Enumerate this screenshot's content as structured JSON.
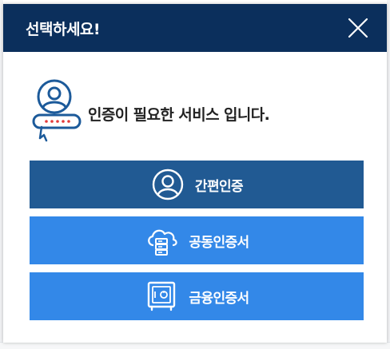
{
  "modal": {
    "title": "선택하세요!",
    "close_icon": "close-icon",
    "notice_icon": "user-id-key-icon",
    "notice_text": "인증이 필요한 서비스 입니다."
  },
  "buttons": [
    {
      "label": "간편인증",
      "icon": "user-circle-icon",
      "color": "#215a93"
    },
    {
      "label": "공동인증서",
      "icon": "cloud-server-icon",
      "color": "#3388e8"
    },
    {
      "label": "금융인증서",
      "icon": "safe-icon",
      "color": "#3388e8"
    }
  ],
  "colors": {
    "header": "#0b2f5c",
    "accent": "#3388e8",
    "dark_button": "#215a93",
    "icon_blue": "#1c5a9a"
  }
}
